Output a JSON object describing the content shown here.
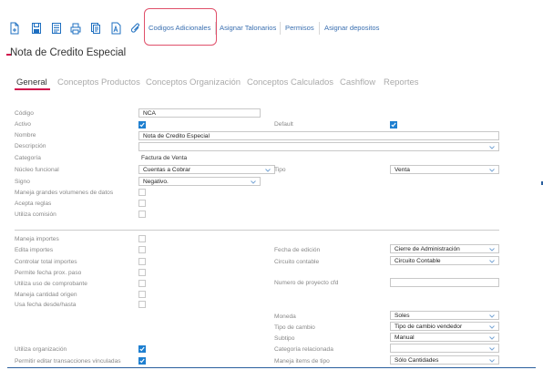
{
  "toolbar": {
    "icons": [
      "new-doc-icon",
      "save-icon",
      "list-icon",
      "print-icon",
      "copy-icon",
      "font-icon",
      "attach-icon"
    ],
    "links": [
      "Codigos Adicionales",
      "Asignar Talonarios",
      "Permisos",
      "Asignar depositos"
    ]
  },
  "title": "Nota de Credito Especial",
  "tabs": [
    "General",
    "Conceptos Productos",
    "Conceptos Organización",
    "Conceptos Calculados",
    "Cashflow",
    "Reportes"
  ],
  "form": {
    "codigo": {
      "label": "Código",
      "value": "NCA"
    },
    "activo": {
      "label": "Activo",
      "checked": true
    },
    "default": {
      "label": "Default",
      "checked": true
    },
    "nombre": {
      "label": "Nombre",
      "value": "Nota de Credito Especial"
    },
    "descripcion": {
      "label": "Descripción",
      "value": ""
    },
    "categoria": {
      "label": "Categoría",
      "value": "Factura de Venta"
    },
    "nucleo": {
      "label": "Núcleo funcional",
      "value": "Cuentas a Cobrar"
    },
    "tipo": {
      "label": "Tipo",
      "value": "Venta"
    },
    "signo": {
      "label": "Signo",
      "value": "Negativo."
    },
    "maneja_grandes": {
      "label": "Maneja grandes volumenes de datos",
      "checked": false
    },
    "acepta_reglas": {
      "label": "Acepta reglas",
      "checked": false
    },
    "utiliza_comision": {
      "label": "Utiliza comisión",
      "checked": false
    },
    "maneja_importes": {
      "label": "Maneja importes",
      "checked": false
    },
    "edita_importes": {
      "label": "Edita importes",
      "checked": false
    },
    "controlar_total": {
      "label": "Controlar total importes",
      "checked": false
    },
    "permite_fecha": {
      "label": "Permite fecha prox. paso",
      "checked": false
    },
    "utiliza_uso": {
      "label": "Utiliza uso de comprobante",
      "checked": false
    },
    "maneja_cantidad": {
      "label": "Maneja cantidad origen",
      "checked": false
    },
    "usa_fecha": {
      "label": "Usa fecha desde/hasta",
      "checked": false
    },
    "fecha_edicion": {
      "label": "Fecha de edición",
      "value": "Cierre de Administración"
    },
    "circuito": {
      "label": "Circuito contable",
      "value": "Circuito Contable"
    },
    "numero_proyecto": {
      "label": "Numero de proyecto cfd",
      "value": ""
    },
    "moneda": {
      "label": "Moneda",
      "value": "Soles"
    },
    "tipo_cambio": {
      "label": "Tipo de cambio",
      "value": "Tipo de cambio vendedor"
    },
    "subtipo": {
      "label": "Subtipo",
      "value": "Manual"
    },
    "utiliza_org": {
      "label": "Utiliza organización",
      "checked": true
    },
    "categoria_rel": {
      "label": "Categoría relacionada",
      "value": ""
    },
    "permitir_editar": {
      "label": "Permitir editar transacciones vinculadas",
      "checked": true
    },
    "maneja_items": {
      "label": "Maneja items de tipo",
      "value": "Sólo Cantidades"
    }
  }
}
